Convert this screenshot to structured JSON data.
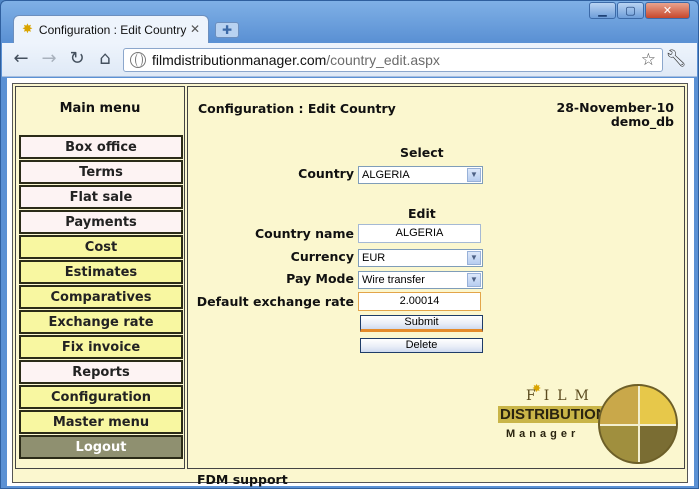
{
  "browser": {
    "tab_title": "Configuration : Edit Country",
    "url_host": "filmdistributionmanager.com",
    "url_path": "/country_edit.aspx",
    "window_controls": {
      "minimize": "▁",
      "maximize": "▢",
      "close": "✕"
    },
    "icons": [
      "back-arrow-icon",
      "forward-arrow-icon",
      "reload-icon",
      "home-icon",
      "bookmark-star-icon",
      "wrench-icon"
    ]
  },
  "sidebar": {
    "title": "Main menu",
    "items": [
      {
        "label": "Box office",
        "style": "pink"
      },
      {
        "label": "Terms",
        "style": "pink"
      },
      {
        "label": "Flat sale",
        "style": "pink"
      },
      {
        "label": "Payments",
        "style": "pink"
      },
      {
        "label": "Cost",
        "style": "yellow"
      },
      {
        "label": "Estimates",
        "style": "yellow"
      },
      {
        "label": "Comparatives",
        "style": "yellow"
      },
      {
        "label": "Exchange rate",
        "style": "yellow"
      },
      {
        "label": "Fix invoice",
        "style": "yellow"
      },
      {
        "label": "Reports",
        "style": "pink"
      },
      {
        "label": "Configuration",
        "style": "yellow"
      },
      {
        "label": "Master menu",
        "style": "yellow"
      },
      {
        "label": "Logout",
        "style": "gray"
      }
    ]
  },
  "main": {
    "title": "Configuration : Edit Country",
    "date": "28-November-10",
    "database": "demo_db",
    "select_section": "Select",
    "country_label": "Country",
    "country_value": "ALGERIA",
    "edit_section": "Edit",
    "country_name_label": "Country name",
    "country_name_value": "ALGERIA",
    "currency_label": "Currency",
    "currency_value": "EUR",
    "pay_mode_label": "Pay Mode",
    "pay_mode_value": "Wire transfer",
    "exchange_rate_label": "Default exchange rate",
    "exchange_rate_value": "2.00014",
    "submit_label": "Submit",
    "delete_label": "Delete"
  },
  "logo": {
    "line1": "FILM",
    "line2": "DISTRIBUTION",
    "line3": "Manager"
  },
  "footer": {
    "support": "FDM support"
  },
  "colors": {
    "page_background": "#fbf7cf",
    "menu_pink": "#fdf3f3",
    "menu_yellow": "#f8f7a1",
    "menu_logout": "#8f9070",
    "submit_underline": "#e58b2a"
  }
}
